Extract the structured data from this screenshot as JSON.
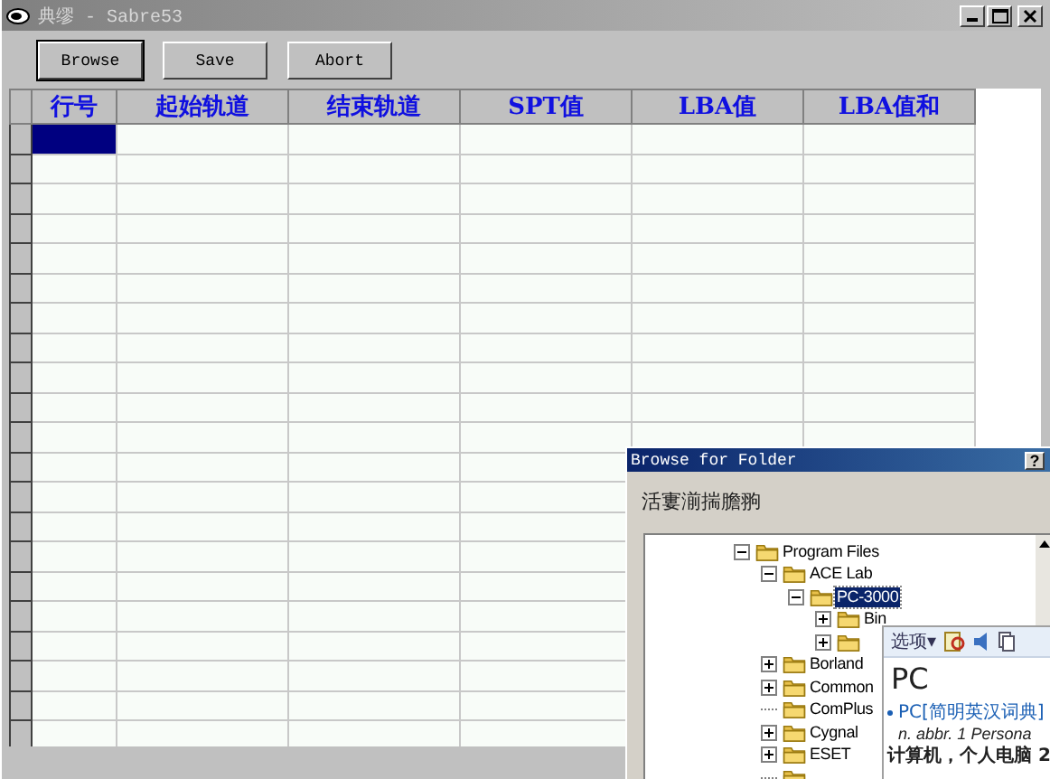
{
  "window": {
    "title": "典缪 - Sabre53"
  },
  "toolbar": {
    "buttons": [
      {
        "label": "Browse",
        "default": true
      },
      {
        "label": "Save",
        "default": false
      },
      {
        "label": "Abort",
        "default": false
      }
    ]
  },
  "grid": {
    "columns": [
      "行号",
      "起始轨道",
      "结束轨道",
      "SPT值",
      "LBA值",
      "LBA值和"
    ],
    "rows": [
      {
        "selected": true
      },
      {
        "selected": false
      },
      {
        "selected": false
      },
      {
        "selected": false
      },
      {
        "selected": false
      },
      {
        "selected": false
      },
      {
        "selected": false
      },
      {
        "selected": false
      },
      {
        "selected": false
      },
      {
        "selected": false
      },
      {
        "selected": false
      },
      {
        "selected": false
      },
      {
        "selected": false
      },
      {
        "selected": false
      },
      {
        "selected": false
      },
      {
        "selected": false
      },
      {
        "selected": false
      },
      {
        "selected": false
      },
      {
        "selected": false
      },
      {
        "selected": false
      },
      {
        "selected": false
      }
    ]
  },
  "dialog": {
    "title": "Browse for Folder",
    "help": "?",
    "prompt": "活寠湔揣膽翑",
    "tree": [
      {
        "label": "Program Files",
        "kind": "node",
        "expanded": true,
        "selected": false,
        "children": [
          {
            "label": "ACE Lab",
            "kind": "node",
            "expanded": true,
            "selected": false,
            "children": [
              {
                "label": "PC-3000",
                "kind": "node",
                "expanded": true,
                "selected": true,
                "children": [
                  {
                    "label": "Bin",
                    "kind": "node",
                    "expanded": false,
                    "selected": false
                  },
                  {
                    "kind": "node",
                    "expanded": false,
                    "selected": false
                  }
                ]
              }
            ]
          },
          {
            "label": "Borland",
            "kind": "node",
            "expanded": false,
            "selected": false
          },
          {
            "label": "Common",
            "kind": "node",
            "expanded": false,
            "selected": false
          },
          {
            "label": "ComPlus",
            "kind": "leaf",
            "selected": false
          },
          {
            "label": "Cygnal",
            "kind": "node",
            "expanded": false,
            "selected": false
          },
          {
            "label": "ESET",
            "kind": "node",
            "expanded": false,
            "selected": false
          },
          {
            "kind": "leaf",
            "selected": false
          }
        ]
      }
    ]
  },
  "dictionary_popup": {
    "menu": "选项▾",
    "headword": "PC",
    "entry": "PC[简明英汉词典]",
    "definition": "n. abbr. 1 Persona",
    "translation": "计算机，个人电脑 2"
  }
}
